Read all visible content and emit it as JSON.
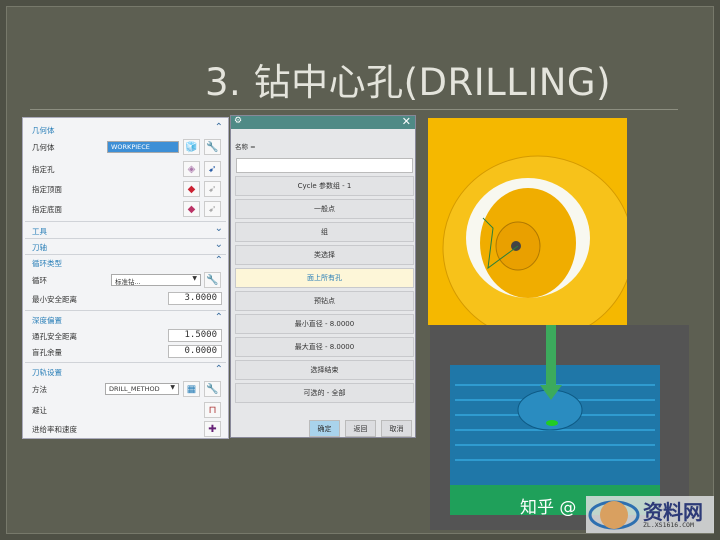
{
  "title": "3. 钻中心孔(DRILLING)",
  "panel": {
    "sections": {
      "geometry": "几何体",
      "tool": "工具",
      "axis": "刀轴",
      "cycle": "循环类型",
      "depth": "深度偏置",
      "path": "刀轨设置"
    },
    "geometry_label": "几何体",
    "geometry_value": "WORKPIECE",
    "specify_hole": "指定孔",
    "specify_top": "指定顶面",
    "specify_bottom": "指定底面",
    "cycle_label": "循环",
    "cycle_value": "标准钻...",
    "min_clearance_label": "最小安全距离",
    "min_clearance_value": "3.0000",
    "through_clearance_label": "通孔安全距离",
    "through_clearance_value": "1.5000",
    "blind_stock_label": "盲孔余量",
    "blind_stock_value": "0.0000",
    "method_label": "方法",
    "method_value": "DRILL_METHOD",
    "avoid_label": "避让",
    "feeds_label": "进给率和速度"
  },
  "dialog": {
    "name_label": "名称 =",
    "name_value": "",
    "buttons": [
      "Cycle 参数组 - 1",
      "一般点",
      "组",
      "类选择",
      "面上所有孔",
      "预钻点",
      "最小直径 - 8.0000",
      "最大直径 - 8.0000",
      "选择结束",
      "可选的 - 全部"
    ],
    "highlighted_index": 4,
    "ok": "确定",
    "back": "返回",
    "cancel": "取消"
  },
  "watermark": {
    "zhihu": "知乎 @",
    "site": "资料网",
    "url": "ZL.XS1616.COM"
  },
  "colors": {
    "accent": "#2a7fb8",
    "dialog_title": "#4f8a86",
    "part_yellow": "#f5b800",
    "model_blue": "#1f77a8"
  }
}
